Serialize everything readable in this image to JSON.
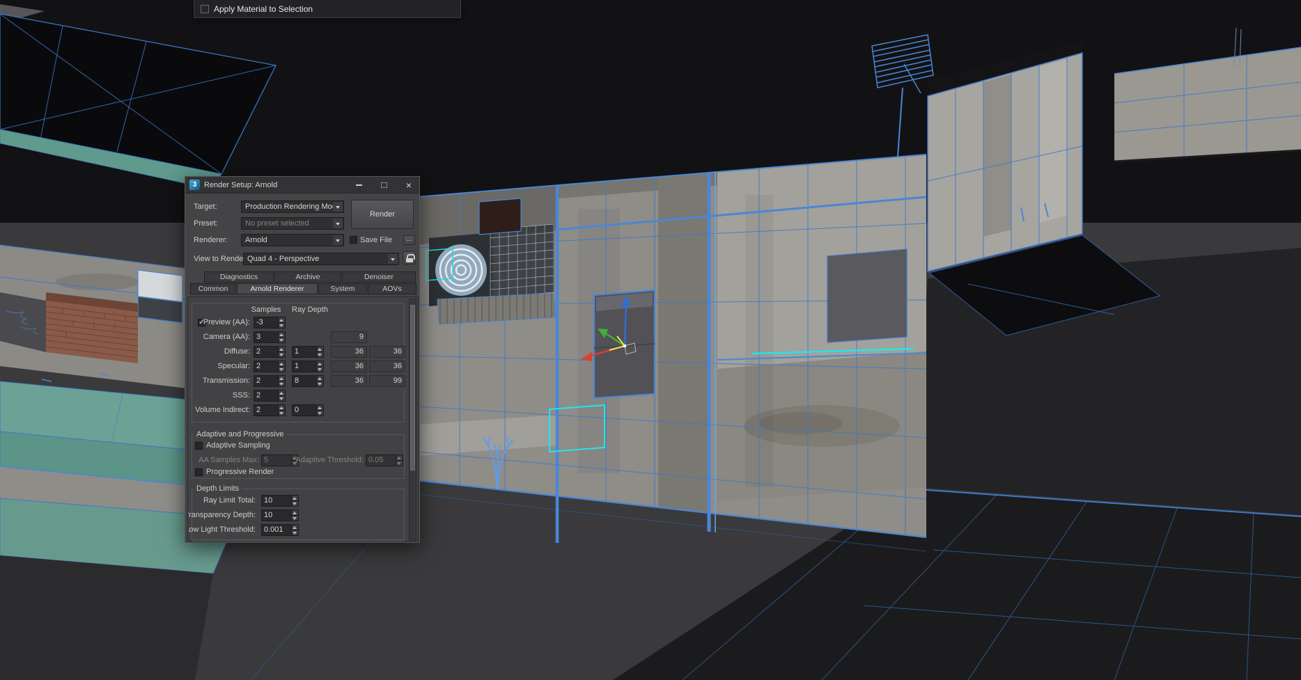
{
  "colors": {
    "wireframe_blue": "#3f77c8",
    "selection_cyan": "#1fe7e7",
    "axis_x_red": "#d8422f",
    "axis_y_green": "#3fae3f",
    "axis_z_blue": "#2f6fd0",
    "axis_highlight_yellow": "#e6e64a"
  },
  "apply_bar": {
    "label": "Apply Material to Selection",
    "checked": false
  },
  "render_dialog": {
    "title": "Render Setup: Arnold",
    "logo_glyph": "3",
    "window": {
      "close_glyph": "×"
    },
    "fields": {
      "target_label": "Target:",
      "target_value": "Production Rendering Mode",
      "preset_label": "Preset:",
      "preset_value": "No preset selected",
      "renderer_label": "Renderer:",
      "renderer_value": "Arnold",
      "save_file_label": "Save File",
      "browse_label": "...",
      "view_label": "View to Render:",
      "view_value": "Quad 4 - Perspective",
      "render_button": "Render"
    },
    "save_file_checked": false,
    "tabs_row1": [
      {
        "label": "Diagnostics"
      },
      {
        "label": "Archive"
      },
      {
        "label": "Denoiser"
      }
    ],
    "tabs_row2": [
      {
        "label": "Common"
      },
      {
        "label": "Arnold Renderer"
      },
      {
        "label": "System"
      },
      {
        "label": "AOVs"
      }
    ],
    "active_tab": "Arnold Renderer",
    "sampling": {
      "header_samples": "Samples",
      "header_ray_depth": "Ray Depth",
      "preview": {
        "label": "Preview (AA):",
        "value": "-3",
        "checked": true
      },
      "camera": {
        "label": "Camera (AA):",
        "value": "3",
        "total": "9"
      },
      "diffuse": {
        "label": "Diffuse:",
        "samples": "2",
        "depth": "1",
        "total1": "36",
        "total2": "36"
      },
      "specular": {
        "label": "Specular:",
        "samples": "2",
        "depth": "1",
        "total1": "36",
        "total2": "36"
      },
      "transmission": {
        "label": "Transmission:",
        "samples": "2",
        "depth": "8",
        "total1": "36",
        "total2": "99"
      },
      "sss": {
        "label": "SSS:",
        "samples": "2"
      },
      "volume": {
        "label": "Volume Indirect:",
        "samples": "2",
        "depth": "0"
      }
    },
    "adaptive": {
      "group_title": "Adaptive and Progressive",
      "adaptive_sampling_label": "Adaptive Sampling",
      "adaptive_sampling_checked": false,
      "aa_samples_max_label": "AA Samples Max:",
      "aa_samples_max_value": "5",
      "adaptive_threshold_label": "Adaptive Threshold:",
      "adaptive_threshold_value": "0.05",
      "progressive_label": "Progressive Render",
      "progressive_checked": false
    },
    "depth_limits": {
      "group_title": "Depth Limits",
      "ray_limit_label": "Ray Limit Total:",
      "ray_limit_value": "10",
      "transparency_label": "Transparency Depth:",
      "transparency_value": "10",
      "low_light_label": "Low Light Threshold:",
      "low_light_value": "0.001"
    }
  }
}
